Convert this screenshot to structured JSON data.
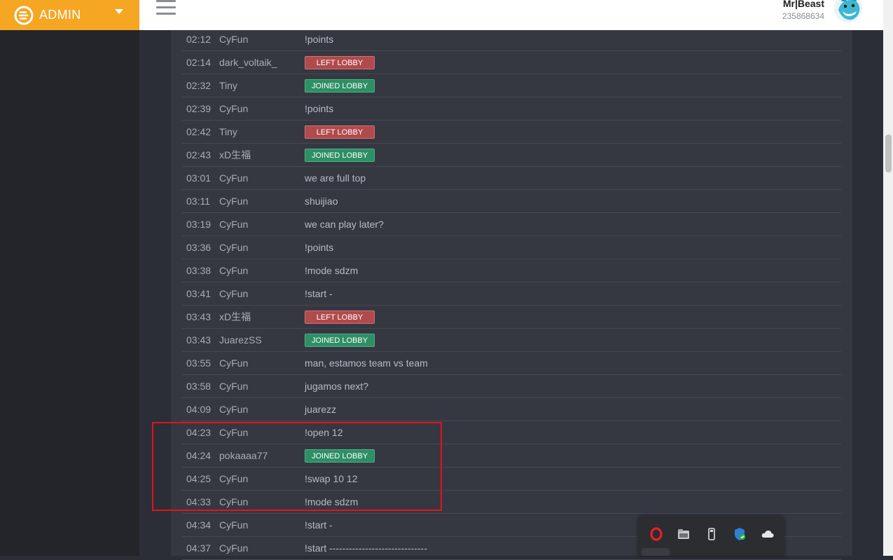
{
  "brand": {
    "label": "ADMIN",
    "color": "#f5a623"
  },
  "user": {
    "name": "Mr|Beast",
    "id": "235868634"
  },
  "badges": {
    "left": "LEFT LOBBY",
    "joined": "JOINED LOBBY"
  },
  "messages": [
    {
      "time": "02:12",
      "user": "CyFun",
      "text": "!points"
    },
    {
      "time": "02:14",
      "user": "dark_voltaik_",
      "badge": "left"
    },
    {
      "time": "02:32",
      "user": "Tiny",
      "badge": "joined"
    },
    {
      "time": "02:39",
      "user": "CyFun",
      "text": "!points"
    },
    {
      "time": "02:42",
      "user": "Tiny",
      "badge": "left"
    },
    {
      "time": "02:43",
      "user": "xD生福",
      "badge": "joined"
    },
    {
      "time": "03:01",
      "user": "CyFun",
      "text": "we are full top"
    },
    {
      "time": "03:11",
      "user": "CyFun",
      "text": "shuijiao"
    },
    {
      "time": "03:19",
      "user": "CyFun",
      "text": "we can play later?"
    },
    {
      "time": "03:36",
      "user": "CyFun",
      "text": "!points"
    },
    {
      "time": "03:38",
      "user": "CyFun",
      "text": "!mode sdzm"
    },
    {
      "time": "03:41",
      "user": "CyFun",
      "text": "!start -"
    },
    {
      "time": "03:43",
      "user": "xD生福",
      "badge": "left"
    },
    {
      "time": "03:43",
      "user": "JuarezSS",
      "badge": "joined"
    },
    {
      "time": "03:55",
      "user": "CyFun",
      "text": "man, estamos team vs team"
    },
    {
      "time": "03:58",
      "user": "CyFun",
      "text": "jugamos next?"
    },
    {
      "time": "04:09",
      "user": "CyFun",
      "text": "juarezz"
    },
    {
      "time": "04:23",
      "user": "CyFun",
      "text": "!open 12"
    },
    {
      "time": "04:24",
      "user": "pokaaaa77",
      "badge": "joined"
    },
    {
      "time": "04:25",
      "user": "CyFun",
      "text": "!swap 10 12"
    },
    {
      "time": "04:33",
      "user": "CyFun",
      "text": "!mode sdzm"
    },
    {
      "time": "04:34",
      "user": "CyFun",
      "text": "!start -"
    },
    {
      "time": "04:37",
      "user": "CyFun",
      "text": "!start ------------------------------"
    }
  ],
  "colors": {
    "badge_left": "#b04a4c",
    "badge_joined": "#2e8e64",
    "highlight": "#e4131b"
  },
  "icons": {
    "brand": "circular-e-logo-icon",
    "dropdown": "caret-down-icon",
    "menu": "hamburger-menu-icon",
    "tray": [
      "opera-browser-icon",
      "file-explorer-icon",
      "usb-drive-icon",
      "windows-security-icon",
      "onedrive-cloud-icon"
    ]
  }
}
